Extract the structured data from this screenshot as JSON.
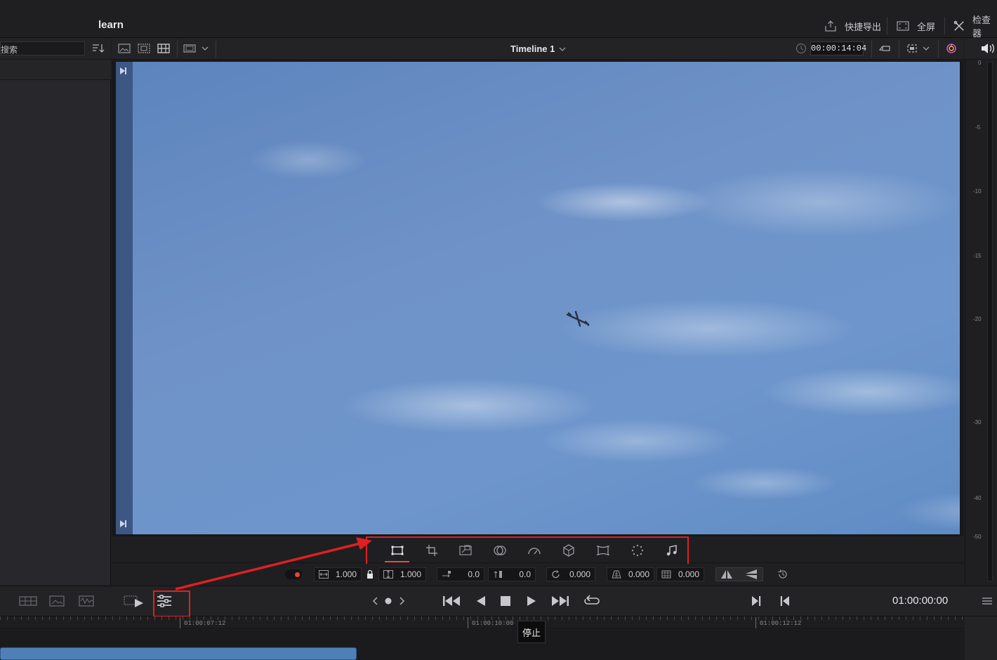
{
  "header": {
    "project_title": "learn",
    "quick_export_label": "快捷导出",
    "fullscreen_label": "全屏",
    "inspector_label": "检查器"
  },
  "media_pool": {
    "search_value": "搜索"
  },
  "viewer": {
    "timeline_name": "Timeline 1",
    "timecode": "00:00:14:04"
  },
  "audio_meter": {
    "labels": [
      "0",
      "-5",
      "-10",
      "-15",
      "-20",
      "-30",
      "-40",
      "-50"
    ]
  },
  "inspector_tools": [
    "transform-icon",
    "crop-icon",
    "dynamic-zoom-icon",
    "composite-icon",
    "speed-icon",
    "stabilize-icon",
    "lens-correction-icon",
    "retime-icon",
    "audio-icon"
  ],
  "transform": {
    "zoom_x": "1.000",
    "zoom_y": "1.000",
    "position_x": "0.0",
    "position_y": "0.0",
    "rotation": "0.000",
    "pitch": "0.000",
    "yaw": "0.000"
  },
  "transport": {
    "timecode": "01:00:00:00",
    "tooltip": "停止"
  },
  "timeline_ruler": {
    "labels": [
      "01:00:07:12",
      "01:00:10:00",
      "01:00:12:12"
    ]
  },
  "colors": {
    "accent_red": "#e02020",
    "clip_blue": "#4e80b6",
    "record_dot": "#e8442f"
  }
}
